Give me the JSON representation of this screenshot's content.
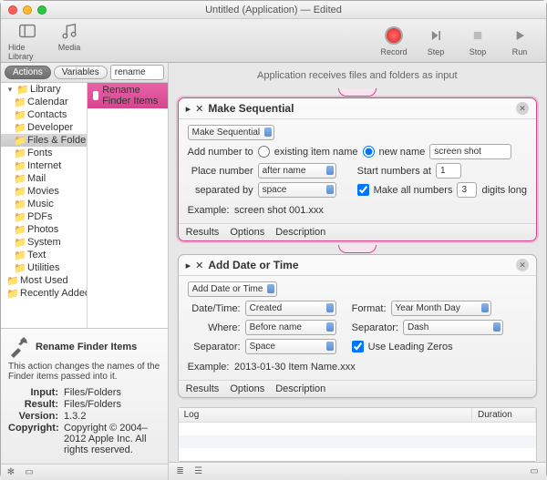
{
  "window": {
    "title": "Untitled (Application) — Edited"
  },
  "toolbar": {
    "left": [
      {
        "name": "hide-library",
        "label": "Hide Library"
      },
      {
        "name": "media",
        "label": "Media"
      }
    ],
    "right": [
      {
        "name": "record",
        "label": "Record"
      },
      {
        "name": "step",
        "label": "Step"
      },
      {
        "name": "stop",
        "label": "Stop"
      },
      {
        "name": "run",
        "label": "Run"
      }
    ]
  },
  "sidebar": {
    "tabs": {
      "actions": "Actions",
      "variables": "Variables"
    },
    "search_value": "rename",
    "tree": {
      "root": "Library",
      "items": [
        "Calendar",
        "Contacts",
        "Developer",
        "Files & Folders",
        "Fonts",
        "Internet",
        "Mail",
        "Movies",
        "Music",
        "PDFs",
        "Photos",
        "System",
        "Text",
        "Utilities"
      ],
      "selected": "Files & Folders",
      "extras": [
        "Most Used",
        "Recently Added"
      ]
    },
    "result": "Rename Finder Items",
    "info": {
      "title": "Rename Finder Items",
      "desc": "This action changes the names of the Finder items passed into it.",
      "rows": [
        {
          "k": "Input:",
          "v": "Files/Folders"
        },
        {
          "k": "Result:",
          "v": "Files/Folders"
        },
        {
          "k": "Version:",
          "v": "1.3.2"
        },
        {
          "k": "Copyright:",
          "v": "Copyright © 2004–2012 Apple Inc. All rights reserved."
        }
      ]
    }
  },
  "workflow": {
    "input_desc": "Application receives files and folders as input",
    "actions": [
      {
        "title": "Make Sequential",
        "mode": "Make Sequential",
        "rows": {
          "add_label": "Add number to",
          "opt_existing": "existing item name",
          "opt_new": "new name",
          "new_value": "screen shot",
          "place_label": "Place number",
          "place_value": "after name",
          "start_label": "Start numbers at",
          "start_value": "1",
          "sep_label": "separated by",
          "sep_value": "space",
          "all_label": "Make all numbers",
          "all_value": "3",
          "digits_label": "digits long"
        },
        "example_label": "Example:",
        "example": "screen shot 001.xxx"
      },
      {
        "title": "Add Date or Time",
        "mode": "Add Date or Time",
        "rows": {
          "dt_label": "Date/Time:",
          "dt_value": "Created",
          "fmt_label": "Format:",
          "fmt_value": "Year Month Day",
          "where_label": "Where:",
          "where_value": "Before name",
          "sep2_label": "Separator:",
          "sep2_value": "Dash",
          "sep3_label": "Separator:",
          "sep3_value": "Space",
          "zeros_label": "Use Leading Zeros"
        },
        "example_label": "Example:",
        "example": "2013-01-30 Item Name.xxx"
      }
    ],
    "tabs": {
      "results": "Results",
      "options": "Options",
      "description": "Description"
    },
    "log": {
      "col1": "Log",
      "col2": "Duration"
    }
  }
}
